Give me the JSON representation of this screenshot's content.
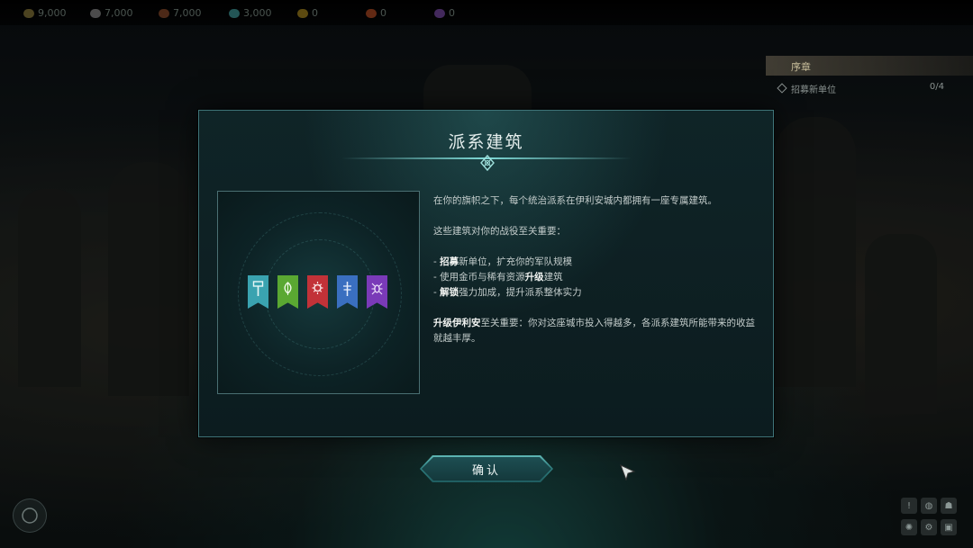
{
  "resources": [
    {
      "icon": "wood-icon",
      "color": "#8a7a3a",
      "value": "9,000"
    },
    {
      "icon": "stone-icon",
      "color": "#8a8a8a",
      "value": "7,000"
    },
    {
      "icon": "ore-icon",
      "color": "#8a4a2a",
      "value": "7,000"
    },
    {
      "icon": "crystal-icon",
      "color": "#3f9a9a",
      "value": "3,000"
    },
    {
      "icon": "gold-icon",
      "color": "#a8861e",
      "value": "0"
    },
    {
      "icon": "mercury-icon",
      "color": "#b24a22",
      "value": "0"
    },
    {
      "icon": "gem-icon",
      "color": "#7a4aa8",
      "value": "0"
    }
  ],
  "quest": {
    "title": "序章",
    "objective": "招募新单位",
    "progress": "0/4"
  },
  "dialog": {
    "title": "派系建筑",
    "intro": "在你的旗帜之下，每个统治派系在伊利安城内都拥有一座专属建筑。",
    "importance": "这些建筑对你的战役至关重要：",
    "bullets": [
      {
        "prefix": "- ",
        "highlight": "招募",
        "mid": "新单位，扩充你的军队规模",
        "highlight2": "",
        "suffix": ""
      },
      {
        "prefix": "- 使用金币与稀有资源",
        "highlight": "升级",
        "mid": "建筑",
        "highlight2": "",
        "suffix": ""
      },
      {
        "prefix": "- ",
        "highlight": "解锁",
        "mid": "强力加成，提升派系整体实力",
        "highlight2": "",
        "suffix": ""
      }
    ],
    "upgrade_highlight": "升级伊利安",
    "upgrade_rest": "至关重要：你对这座城市投入得越多，各派系建筑所能带来的收益就越丰厚。",
    "banners": [
      {
        "icon": "hammer-icon",
        "color": "#3aa3b0"
      },
      {
        "icon": "leaf-icon",
        "color": "#5aa832"
      },
      {
        "icon": "sun-icon",
        "color": "#c23238"
      },
      {
        "icon": "spear-icon",
        "color": "#3a6fc0"
      },
      {
        "icon": "spider-icon",
        "color": "#7a3ab8"
      }
    ]
  },
  "confirm_label": "确认",
  "bottom_right_icons": [
    "alert-icon",
    "globe-icon",
    "helmet-icon",
    "gear-icon",
    "settings-icon",
    "save-icon"
  ]
}
